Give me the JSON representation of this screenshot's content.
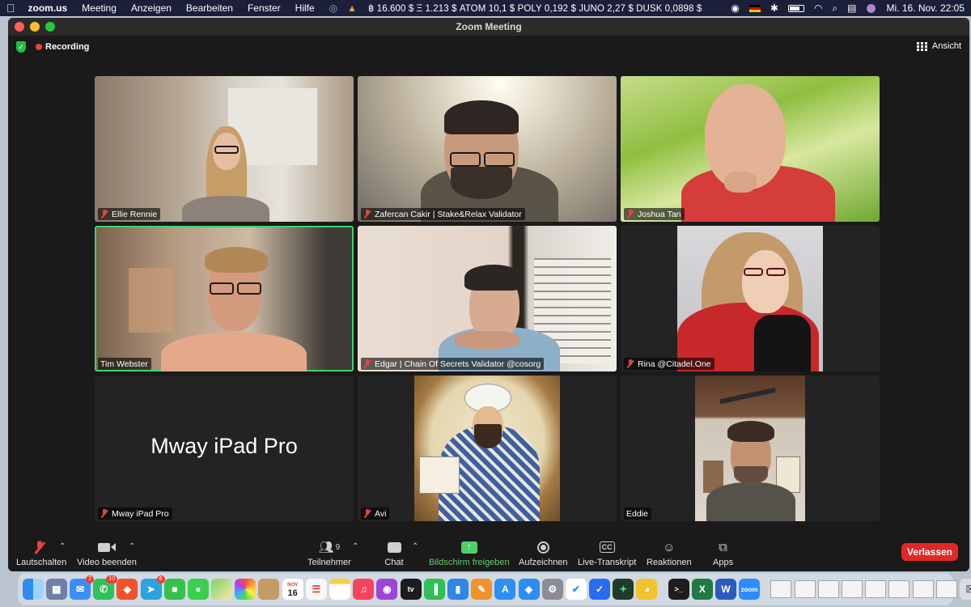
{
  "menubar": {
    "app_name": "zoom.us",
    "menus": [
      "Meeting",
      "Anzeigen",
      "Bearbeiten",
      "Fenster",
      "Hilfe"
    ],
    "ticker": "฿ 16.600 $ Ξ 1.213 $ ATOM 10,1 $ POLY 0,192 $ JUNO 2,27 $ DUSK 0,0898 $",
    "datetime": "Mi. 16. Nov.  22:05"
  },
  "window": {
    "title": "Zoom Meeting",
    "recording_label": "Recording",
    "view_label": "Ansicht"
  },
  "participants": [
    {
      "name": "Ellie Rennie",
      "muted": true
    },
    {
      "name": "Zafercan Cakir  | Stake&Relax Validator",
      "muted": true
    },
    {
      "name": "Joshua Tan",
      "muted": true
    },
    {
      "name": "Tim Webster",
      "muted": false,
      "active_speaker": true
    },
    {
      "name": "Edgar | Chain Of Secrets Validator @cosorg",
      "muted": true
    },
    {
      "name": "Rina @Citadel.One",
      "muted": true
    },
    {
      "name": "Mway iPad Pro",
      "muted": true,
      "video_off": true,
      "display_text": "Mway iPad Pro"
    },
    {
      "name": "Avi",
      "muted": true
    },
    {
      "name": "Eddie",
      "muted": false
    }
  ],
  "toolbar": {
    "mute": "Lautschalten",
    "video": "Video beenden",
    "participants": "Teilnehmer",
    "participants_count": "9",
    "chat": "Chat",
    "share": "Bildschirm freigeben",
    "record": "Aufzeichnen",
    "transcript": "Live-Transkript",
    "reactions": "Reaktionen",
    "apps": "Apps",
    "leave": "Verlassen"
  },
  "dock": {
    "calendar_month": "NOV",
    "calendar_day": "16",
    "mail_badge": "2",
    "whatsapp_badge": "10",
    "telegram_badge": "6"
  }
}
